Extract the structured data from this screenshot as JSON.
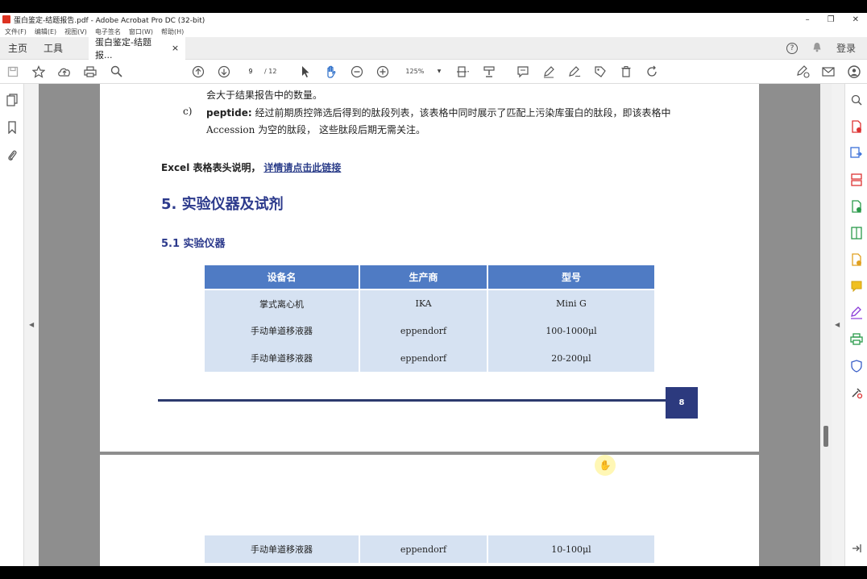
{
  "window": {
    "title": "蛋白鉴定-结题报告.pdf - Adobe Acrobat Pro DC (32-bit)",
    "controls": [
      "–",
      "❐",
      "✕"
    ]
  },
  "menu": [
    "文件(F)",
    "编辑(E)",
    "视图(V)",
    "电子签名",
    "窗口(W)",
    "帮助(H)"
  ],
  "tabs": {
    "home": "主页",
    "tools": "工具",
    "document": "蛋白鉴定-结题报...",
    "close": "×",
    "help": "?",
    "signin": "登录"
  },
  "toolbar": {
    "current_page": "9",
    "total_pages": "/ 12",
    "zoom": "125%"
  },
  "document": {
    "line_top": "会大于结果报告中的数量。",
    "item_c_label": "c)",
    "item_c_term": "peptide:",
    "item_c_text": "经过前期质控筛选后得到的肽段列表，该表格中同时展示了匹配上污染库蛋白的肽段，即该表格中",
    "item_c_text2": "Accession 为空的肽段，  这些肽段后期无需关注。",
    "excel_label": "Excel  表格表头说明，",
    "excel_link": "详情请点击此链接",
    "section_title": "5.  实验仪器及试剂",
    "subsection_title": "5.1  实验仪器",
    "table_headers": [
      "设备名",
      "生产商",
      "型号"
    ],
    "table_rows": [
      [
        "掌式离心机",
        "IKA",
        "Mini G"
      ],
      [
        "手动单道移液器",
        "eppendorf",
        "100-1000μl"
      ],
      [
        "手动单道移液器",
        "eppendorf",
        "20-200μl"
      ]
    ],
    "page_number": "8",
    "page2_row": [
      "手动单道移液器",
      "eppendorf",
      "10-100μl"
    ]
  },
  "colors": {
    "heading": "#2c3a8c",
    "table_header": "#4f7bc4",
    "table_cell": "#d6e2f2",
    "footer": "#2c3a7e"
  }
}
